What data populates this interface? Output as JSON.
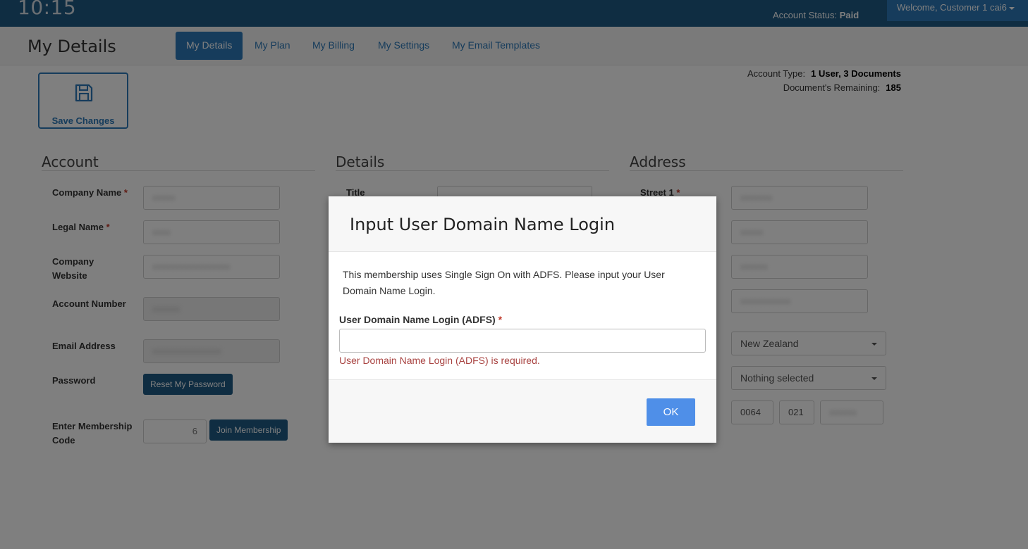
{
  "header": {
    "clock": "10:15",
    "account_status_label": "Account Status:",
    "account_status_value": "Paid",
    "welcome": "Welcome, Customer 1 cai6"
  },
  "subheader": {
    "title": "My Details",
    "tabs": [
      {
        "label": "My Details",
        "active": true
      },
      {
        "label": "My Plan"
      },
      {
        "label": "My Billing"
      },
      {
        "label": "My Settings"
      },
      {
        "label": "My Email Templates"
      }
    ]
  },
  "toolbar": {
    "save_label": "Save Changes",
    "save_icon": "floppy-disk-icon"
  },
  "account_info": {
    "type_label": "Account Type:",
    "type_value": "1 User, 3 Documents",
    "remaining_label": "Document's Remaining:",
    "remaining_value": "185"
  },
  "sections": {
    "account": "Account",
    "details": "Details",
    "address": "Address"
  },
  "account_form": {
    "company_name": "Company Name",
    "legal_name": "Legal Name",
    "company_website": "Company Website",
    "account_number": "Account Number",
    "email_address": "Email Address",
    "password": "Password",
    "reset_password": "Reset My Password",
    "membership_code": "Enter Membership Code",
    "join_membership": "Join Membership",
    "membership_code_value": "6"
  },
  "details_form": {
    "title_label": "Title"
  },
  "address_form": {
    "street1": "Street 1",
    "country": "New Zealand",
    "region": "Nothing selected",
    "phone_country": "0064",
    "phone_area": "021"
  },
  "modal": {
    "title": "Input User Domain Name Login",
    "message": "This membership uses Single Sign On with ADFS. Please input your User Domain Name Login.",
    "field_label": "User Domain Name Login (ADFS)",
    "required_mark": "*",
    "input_value": "",
    "error": "User Domain Name Login (ADFS) is required.",
    "ok_label": "OK"
  },
  "colors": {
    "brand": "#2c79b8",
    "topbar": "#1f5a85",
    "error": "#a94442",
    "ok_button": "#4f8fe8"
  }
}
